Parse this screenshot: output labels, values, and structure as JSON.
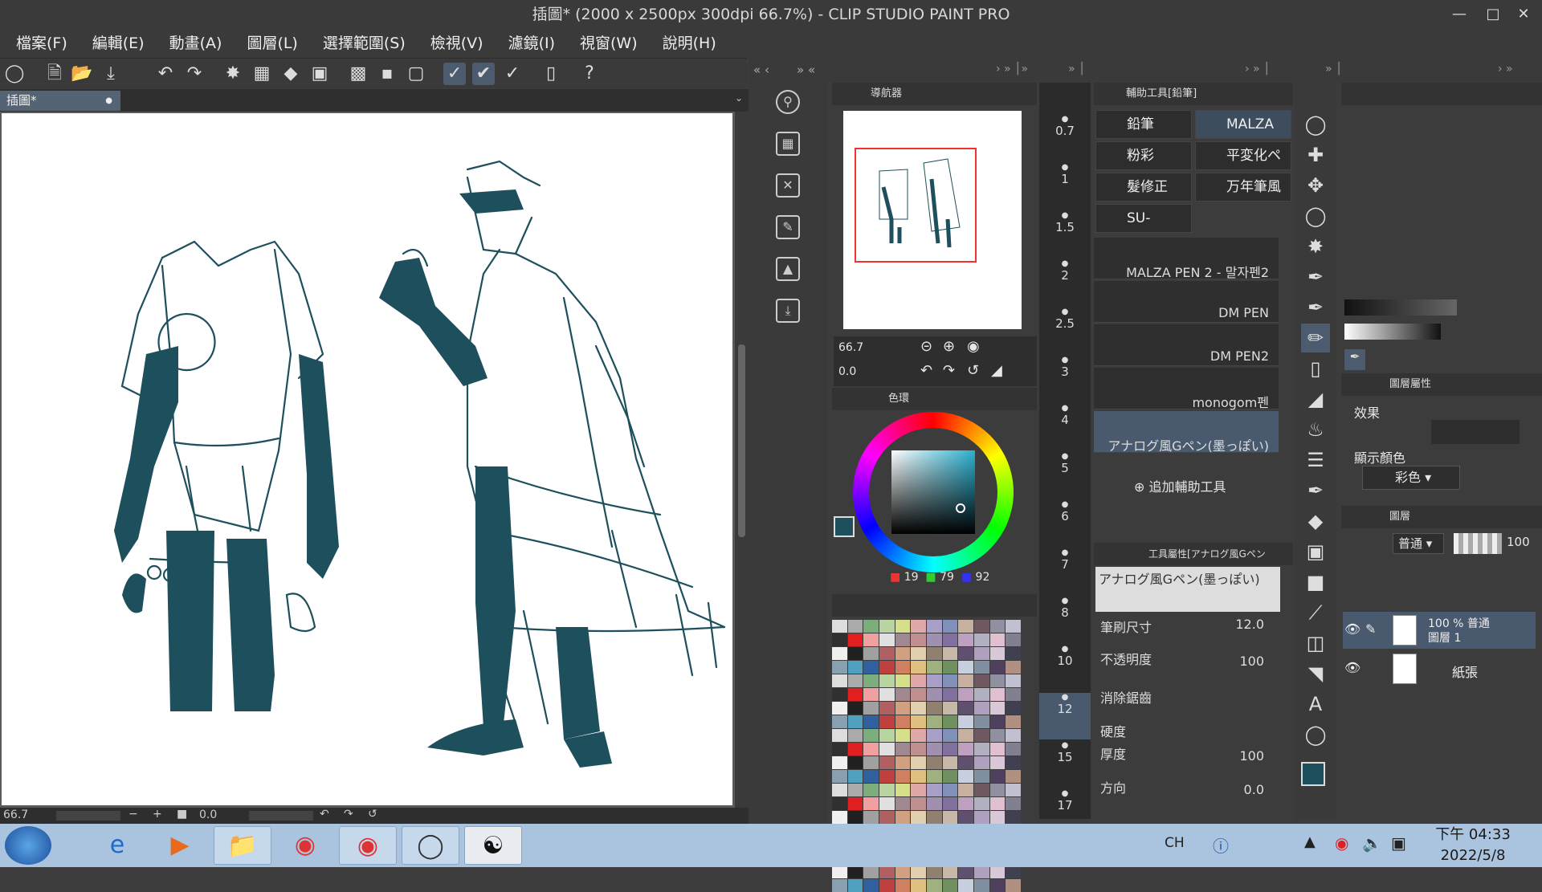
{
  "window": {
    "title": "插圖* (2000 x 2500px 300dpi 66.7%)  - CLIP STUDIO PAINT PRO"
  },
  "menu": [
    "檔案(F)",
    "編輯(E)",
    "動畫(A)",
    "圖層(L)",
    "選擇範圍(S)",
    "檢視(V)",
    "濾鏡(I)",
    "視窗(W)",
    "說明(H)"
  ],
  "doc": {
    "tab_label": "插圖*"
  },
  "status": {
    "zoom": "66.7",
    "angle": "0.0"
  },
  "navigator": {
    "title": "導航器",
    "zoom": "66.7",
    "rotation": "0.0"
  },
  "color": {
    "title": "色環",
    "r": "19",
    "g": "79",
    "b": "92",
    "main_color": "#1e4f5c"
  },
  "brush_sizes": [
    "0.7",
    "1",
    "1.5",
    "2",
    "2.5",
    "3",
    "4",
    "5",
    "6",
    "7",
    "8",
    "10",
    "12",
    "15",
    "17"
  ],
  "subtool": {
    "title": "輔助工具[鉛筆]",
    "groups": [
      "鉛筆",
      "MALZA PE",
      "粉彩",
      "平変化ペン",
      "髮修正",
      "万年筆風ペ",
      "SU-Cream I"
    ],
    "brushes": [
      "MALZA PEN 2 - 말자펜2",
      "DM PEN",
      "DM PEN2",
      "monogom펜",
      "アナログ風Gペン(墨っぽい)"
    ],
    "add_label": "追加輔助工具"
  },
  "toolprop": {
    "title": "工具屬性[アナログ風Gペン",
    "brush_name": "アナログ風Gペン(墨っぽい)",
    "size_label": "筆刷尺寸",
    "size": "12.0",
    "opacity_label": "不透明度",
    "opacity": "100",
    "aa_label": "消除鋸齒",
    "hardness_label": "硬度",
    "thickness_label": "厚度",
    "thickness": "100",
    "direction_label": "方向",
    "direction": "0.0"
  },
  "layer_prop": {
    "title": "圖層屬性",
    "effect_label": "效果",
    "display_color_label": "顯示顏色",
    "display_color": "彩色"
  },
  "layers": {
    "title": "圖層",
    "blend_mode": "普通",
    "opacity": "100",
    "items": [
      {
        "line1": "100 % 普通",
        "line2": "圖層 1"
      },
      {
        "line1": "紙張",
        "line2": ""
      }
    ]
  },
  "taskbar": {
    "lang": "CH",
    "time": "下午 04:33",
    "date": "2022/5/8"
  }
}
